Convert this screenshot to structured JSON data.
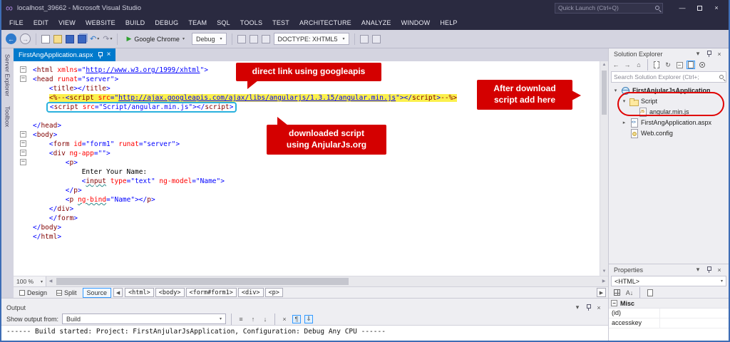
{
  "window": {
    "title": "localhost_39662 - Microsoft Visual Studio",
    "quick_launch_placeholder": "Quick Launch (Ctrl+Q)"
  },
  "menu": {
    "items": [
      "FILE",
      "EDIT",
      "VIEW",
      "WEBSITE",
      "BUILD",
      "DEBUG",
      "TEAM",
      "SQL",
      "TOOLS",
      "TEST",
      "ARCHITECTURE",
      "ANALYZE",
      "WINDOW",
      "HELP"
    ]
  },
  "toolbar": {
    "run_target": "Google Chrome",
    "configuration": "Debug",
    "doctype": "DOCTYPE: XHTML5"
  },
  "side_strip": {
    "tabs": [
      "Server Explorer",
      "Toolbox"
    ]
  },
  "editor": {
    "tab_label": "FirstAngApplication.aspx",
    "zoom": "100 %",
    "views": [
      "Design",
      "Split",
      "Source"
    ],
    "active_view": "Source",
    "breadcrumbs": [
      "<html>",
      "<body>",
      "<form#form1>",
      "<div>",
      "<p>"
    ],
    "code_lines": [
      {
        "fold": true,
        "tokens": [
          [
            "d",
            "<"
          ],
          [
            "t",
            "html"
          ],
          [
            "x",
            " "
          ],
          [
            "a",
            "xmlns"
          ],
          [
            "d",
            "=\""
          ],
          [
            "u",
            "http://www.w3.org/1999/xhtml"
          ],
          [
            "d",
            "\">"
          ]
        ]
      },
      {
        "fold": true,
        "tokens": [
          [
            "d",
            "<"
          ],
          [
            "t",
            "head"
          ],
          [
            "x",
            " "
          ],
          [
            "a",
            "runat"
          ],
          [
            "d",
            "=\""
          ],
          [
            "v",
            "server"
          ],
          [
            "d",
            "\">"
          ]
        ]
      },
      {
        "indent": "    ",
        "tokens": [
          [
            "d",
            "<"
          ],
          [
            "t",
            "title"
          ],
          [
            "d",
            "></"
          ],
          [
            "t",
            "title"
          ],
          [
            "d",
            ">"
          ]
        ]
      },
      {
        "indent": "    ",
        "hl": "yellow",
        "tokens": [
          [
            "c",
            "<%--"
          ],
          [
            "d",
            "<"
          ],
          [
            "t",
            "script"
          ],
          [
            "x",
            " "
          ],
          [
            "a",
            "src"
          ],
          [
            "d",
            "=\""
          ],
          [
            "u",
            "http://ajax.googleapis.com/ajax/libs/angularjs/1.3.15/angular.min.js"
          ],
          [
            "d",
            "\"></"
          ],
          [
            "t",
            "script"
          ],
          [
            "d",
            ">"
          ],
          [
            "c",
            "--%>"
          ]
        ]
      },
      {
        "indent": "    ",
        "box": "cyan",
        "tokens": [
          [
            "d",
            "<"
          ],
          [
            "t",
            "script"
          ],
          [
            "x",
            " "
          ],
          [
            "a",
            "src"
          ],
          [
            "d",
            "=\""
          ],
          [
            "v",
            "Script/angular.min.js"
          ],
          [
            "d",
            "\"></"
          ],
          [
            "t",
            "script"
          ],
          [
            "d",
            ">"
          ]
        ]
      },
      {
        "tokens": []
      },
      {
        "tokens": [
          [
            "d",
            "</"
          ],
          [
            "t",
            "head"
          ],
          [
            "d",
            ">"
          ]
        ]
      },
      {
        "fold": true,
        "tokens": [
          [
            "d",
            "<"
          ],
          [
            "t",
            "body"
          ],
          [
            "d",
            ">"
          ]
        ]
      },
      {
        "fold": true,
        "indent": "    ",
        "tokens": [
          [
            "d",
            "<"
          ],
          [
            "t",
            "form"
          ],
          [
            "x",
            " "
          ],
          [
            "a",
            "id"
          ],
          [
            "d",
            "=\""
          ],
          [
            "v",
            "form1"
          ],
          [
            "d",
            "\""
          ],
          [
            "x",
            " "
          ],
          [
            "a",
            "runat"
          ],
          [
            "d",
            "=\""
          ],
          [
            "v",
            "server"
          ],
          [
            "d",
            "\">"
          ]
        ]
      },
      {
        "fold": true,
        "indent": "    ",
        "tokens": [
          [
            "d",
            "<"
          ],
          [
            "t",
            "div"
          ],
          [
            "x",
            " "
          ],
          [
            "a",
            "ng-app"
          ],
          [
            "d",
            "=\"\">"
          ]
        ]
      },
      {
        "fold": true,
        "indent": "        ",
        "tokens": [
          [
            "d",
            "<"
          ],
          [
            "t",
            "p"
          ],
          [
            "d",
            ">"
          ]
        ]
      },
      {
        "indent": "            ",
        "tokens": [
          [
            "x",
            "Enter Your Name:"
          ]
        ]
      },
      {
        "indent": "            ",
        "tokens": [
          [
            "d",
            "<"
          ],
          [
            "t",
            "input",
            "sq"
          ],
          [
            "x",
            " "
          ],
          [
            "a",
            "type"
          ],
          [
            "d",
            "=\""
          ],
          [
            "v",
            "text"
          ],
          [
            "d",
            "\""
          ],
          [
            "x",
            " "
          ],
          [
            "a",
            "ng-model"
          ],
          [
            "d",
            "=\""
          ],
          [
            "v",
            "Name"
          ],
          [
            "d",
            "\">"
          ]
        ]
      },
      {
        "indent": "        ",
        "tokens": [
          [
            "d",
            "</"
          ],
          [
            "t",
            "p"
          ],
          [
            "d",
            ">"
          ]
        ]
      },
      {
        "indent": "        ",
        "tokens": [
          [
            "d",
            "<"
          ],
          [
            "t",
            "p"
          ],
          [
            "x",
            " "
          ],
          [
            "a",
            "ng-bind",
            "sq"
          ],
          [
            "d",
            "=\""
          ],
          [
            "v",
            "Name"
          ],
          [
            "d",
            "\"></"
          ],
          [
            "t",
            "p"
          ],
          [
            "d",
            ">"
          ]
        ]
      },
      {
        "indent": "    ",
        "tokens": [
          [
            "d",
            "</"
          ],
          [
            "t",
            "div"
          ],
          [
            "d",
            ">"
          ]
        ]
      },
      {
        "indent": "    ",
        "tokens": [
          [
            "d",
            "</"
          ],
          [
            "t",
            "form"
          ],
          [
            "d",
            ">"
          ]
        ]
      },
      {
        "tokens": [
          [
            "d",
            "</"
          ],
          [
            "t",
            "body"
          ],
          [
            "d",
            ">"
          ]
        ]
      },
      {
        "tokens": [
          [
            "d",
            "</"
          ],
          [
            "t",
            "html"
          ],
          [
            "d",
            ">"
          ]
        ]
      }
    ]
  },
  "callouts": [
    {
      "id": "googleapis",
      "lines": [
        "direct link using googleapis"
      ]
    },
    {
      "id": "after-download",
      "lines": [
        "After download",
        "script add here"
      ]
    },
    {
      "id": "downloaded",
      "lines": [
        "downloaded script",
        "using AnjularJs.org"
      ]
    }
  ],
  "solution_explorer": {
    "title": "Solution Explorer",
    "search_placeholder": "Search Solution Explorer (Ctrl+;",
    "items": [
      {
        "label": "FirstAnjularJsApplication",
        "icon": "web-project-icon",
        "indent": 0,
        "expander": "▾",
        "bold": true
      },
      {
        "label": "Script",
        "icon": "folder-icon",
        "indent": 1,
        "expander": "▾"
      },
      {
        "label": "angular.min.js",
        "icon": "js-file-icon",
        "indent": 2,
        "expander": ""
      },
      {
        "label": "FirstAngApplication.aspx",
        "icon": "aspx-file-icon",
        "indent": 1,
        "expander": "▸"
      },
      {
        "label": "Web.config",
        "icon": "config-file-icon",
        "indent": 1,
        "expander": ""
      }
    ]
  },
  "properties": {
    "title": "Properties",
    "object": "<HTML>",
    "section": "Misc",
    "rows": [
      {
        "name": "(id)",
        "value": ""
      },
      {
        "name": "accesskey",
        "value": ""
      }
    ]
  },
  "output": {
    "title": "Output",
    "from_label": "Show output from:",
    "source": "Build",
    "lines": [
      "------ Build started: Project: FirstAnjularJsApplication, Configuration: Debug Any CPU ------"
    ]
  }
}
